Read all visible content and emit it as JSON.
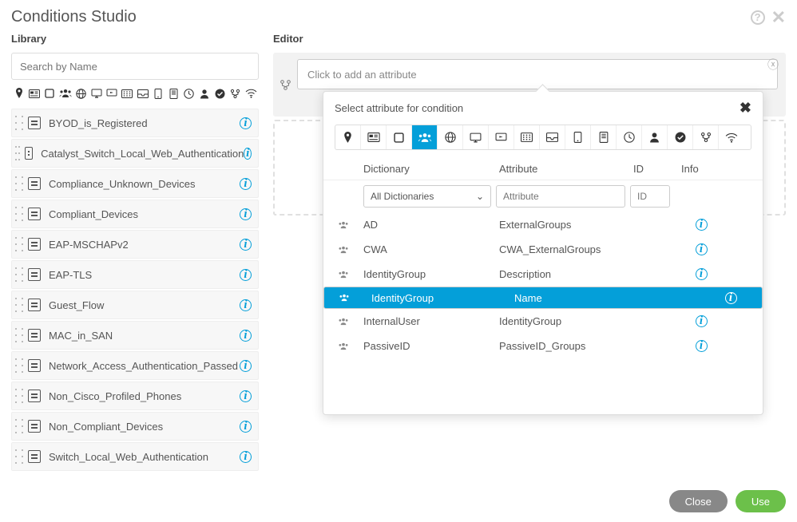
{
  "title": "Conditions Studio",
  "library": {
    "label": "Library",
    "search_placeholder": "Search by Name",
    "items": [
      {
        "label": "BYOD_is_Registered"
      },
      {
        "label": "Catalyst_Switch_Local_Web_Authentication"
      },
      {
        "label": "Compliance_Unknown_Devices"
      },
      {
        "label": "Compliant_Devices"
      },
      {
        "label": "EAP-MSCHAPv2"
      },
      {
        "label": "EAP-TLS"
      },
      {
        "label": "Guest_Flow"
      },
      {
        "label": "MAC_in_SAN"
      },
      {
        "label": "Network_Access_Authentication_Passed"
      },
      {
        "label": "Non_Cisco_Profiled_Phones"
      },
      {
        "label": "Non_Compliant_Devices"
      },
      {
        "label": "Switch_Local_Web_Authentication"
      }
    ]
  },
  "editor": {
    "label": "Editor",
    "placeholder": "Click to add an attribute"
  },
  "popover": {
    "title": "Select attribute for condition",
    "columns": {
      "dict": "Dictionary",
      "attr": "Attribute",
      "id": "ID",
      "info": "Info"
    },
    "filter": {
      "dict_select": "All Dictionaries",
      "attr_placeholder": "Attribute",
      "id_placeholder": "ID"
    },
    "rows": [
      {
        "dict": "AD",
        "attr": "ExternalGroups",
        "selected": false
      },
      {
        "dict": "CWA",
        "attr": "CWA_ExternalGroups",
        "selected": false
      },
      {
        "dict": "IdentityGroup",
        "attr": "Description",
        "selected": false
      },
      {
        "dict": "IdentityGroup",
        "attr": "Name",
        "selected": true
      },
      {
        "dict": "InternalUser",
        "attr": "IdentityGroup",
        "selected": false
      },
      {
        "dict": "PassiveID",
        "attr": "PassiveID_Groups",
        "selected": false
      }
    ]
  },
  "buttons": {
    "close": "Close",
    "use": "Use"
  }
}
